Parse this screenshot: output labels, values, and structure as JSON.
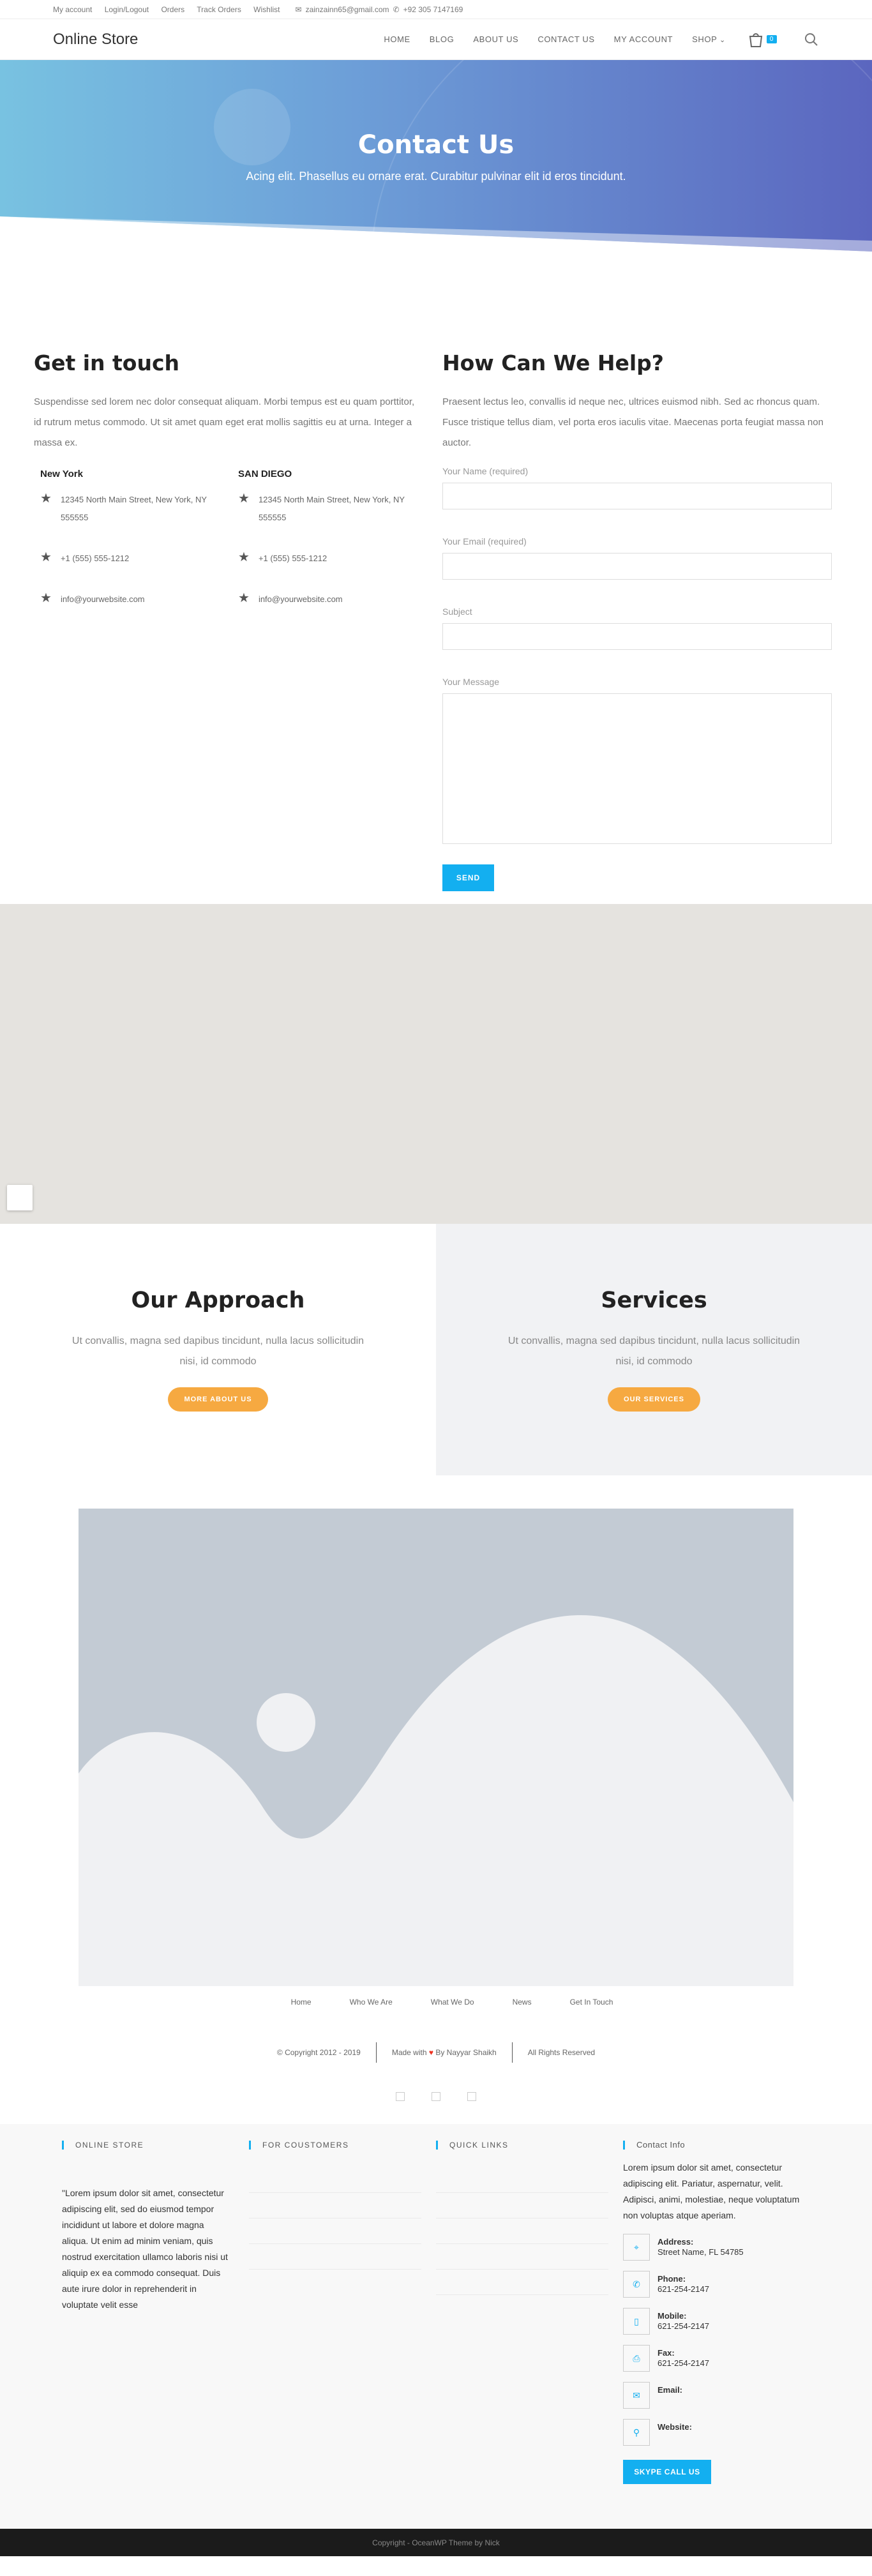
{
  "topbar": {
    "links": [
      "My account",
      "Login/Logout",
      "Orders",
      "Track Orders",
      "Wishlist"
    ],
    "email": "zainzainn65@gmail.com",
    "phone": "+92 305 7147169"
  },
  "header": {
    "logo": "Online Store",
    "nav": [
      "HOME",
      "BLOG",
      "ABOUT US",
      "CONTACT US",
      "MY ACCOUNT"
    ],
    "shop": "SHOP",
    "cart_count": "0"
  },
  "hero": {
    "title": "Contact Us",
    "subtitle": "Acing elit. Phasellus eu ornare erat. Curabitur pulvinar elit id eros tincidunt."
  },
  "get_in_touch": {
    "title": "Get in touch",
    "desc": "Suspendisse sed lorem nec dolor consequat aliquam. Morbi tempus est eu quam porttitor, id rutrum metus commodo. Ut sit amet quam eget erat mollis sagittis eu at urna. Integer a massa ex.",
    "offices": [
      {
        "city": "New York",
        "address": "12345 North Main Street, New York, NY 555555",
        "phone": "+1 (555) 555-1212",
        "email": "info@yourwebsite.com"
      },
      {
        "city": "SAN DIEGO",
        "address": "12345 North Main Street, New York, NY 555555",
        "phone": "+1 (555) 555-1212",
        "email": "info@yourwebsite.com"
      }
    ]
  },
  "help": {
    "title": "How Can We Help?",
    "desc": "Praesent lectus leo, convallis id neque nec, ultrices euismod nibh. Sed ac rhoncus quam. Fusce tristique tellus diam, vel porta eros iaculis vitae. Maecenas porta feugiat massa non auctor.",
    "labels": {
      "name": "Your Name (required)",
      "email": "Your Email (required)",
      "subject": "Subject",
      "message": "Your Message"
    },
    "send": "SEND"
  },
  "boxes": {
    "approach": {
      "title": "Our Approach",
      "text": "Ut convallis, magna sed dapibus tincidunt, nulla lacus sollicitudin nisi, id commodo",
      "button": "MORE ABOUT US"
    },
    "services": {
      "title": "Services",
      "text": "Ut convallis, magna sed dapibus tincidunt, nulla lacus sollicitudin nisi, id commodo",
      "button": "OUR SERVICES"
    }
  },
  "bottom_links": [
    "Home",
    "Who We Are",
    "What We Do",
    "News",
    "Get In Touch"
  ],
  "bottom_meta": {
    "copyright": "© Copyright 2012 - 2019",
    "made_with": "Made with",
    "by": "By Nayyar Shaikh",
    "rights": "All Rights Reserved"
  },
  "footer": {
    "online_store": {
      "title": "ONLINE STORE",
      "text": "\"Lorem ipsum dolor sit amet, consectetur adipiscing elit, sed do eiusmod tempor incididunt ut labore et dolore magna aliqua. Ut enim ad minim veniam, quis nostrud exercitation ullamco laboris nisi ut aliquip ex ea commodo consequat. Duis aute irure dolor in reprehenderit in voluptate velit esse"
    },
    "customers": {
      "title": "FOR COUSTOMERS"
    },
    "quick_links": {
      "title": "QUICK LINKS"
    },
    "contact_info": {
      "title": "Contact Info",
      "intro": "Lorem ipsum dolor sit amet, consectetur adipiscing elit. Pariatur, aspernatur, velit. Adipisci, animi, molestiae, neque voluptatum non voluptas atque aperiam.",
      "address_label": "Address:",
      "address": "Street Name, FL 54785",
      "phone_label": "Phone:",
      "phone": "621-254-2147",
      "mobile_label": "Mobile:",
      "mobile": "621-254-2147",
      "fax_label": "Fax:",
      "fax": "621-254-2147",
      "email_label": "Email:",
      "website_label": "Website:",
      "skype": "SKYPE CALL US"
    }
  },
  "copyright_bar": "Copyright - OceanWP Theme by Nick",
  "colors": {
    "accent": "#13aff0",
    "orange": "#f6a941",
    "hero_start": "#78c2e1",
    "hero_end": "#5b66bf"
  }
}
